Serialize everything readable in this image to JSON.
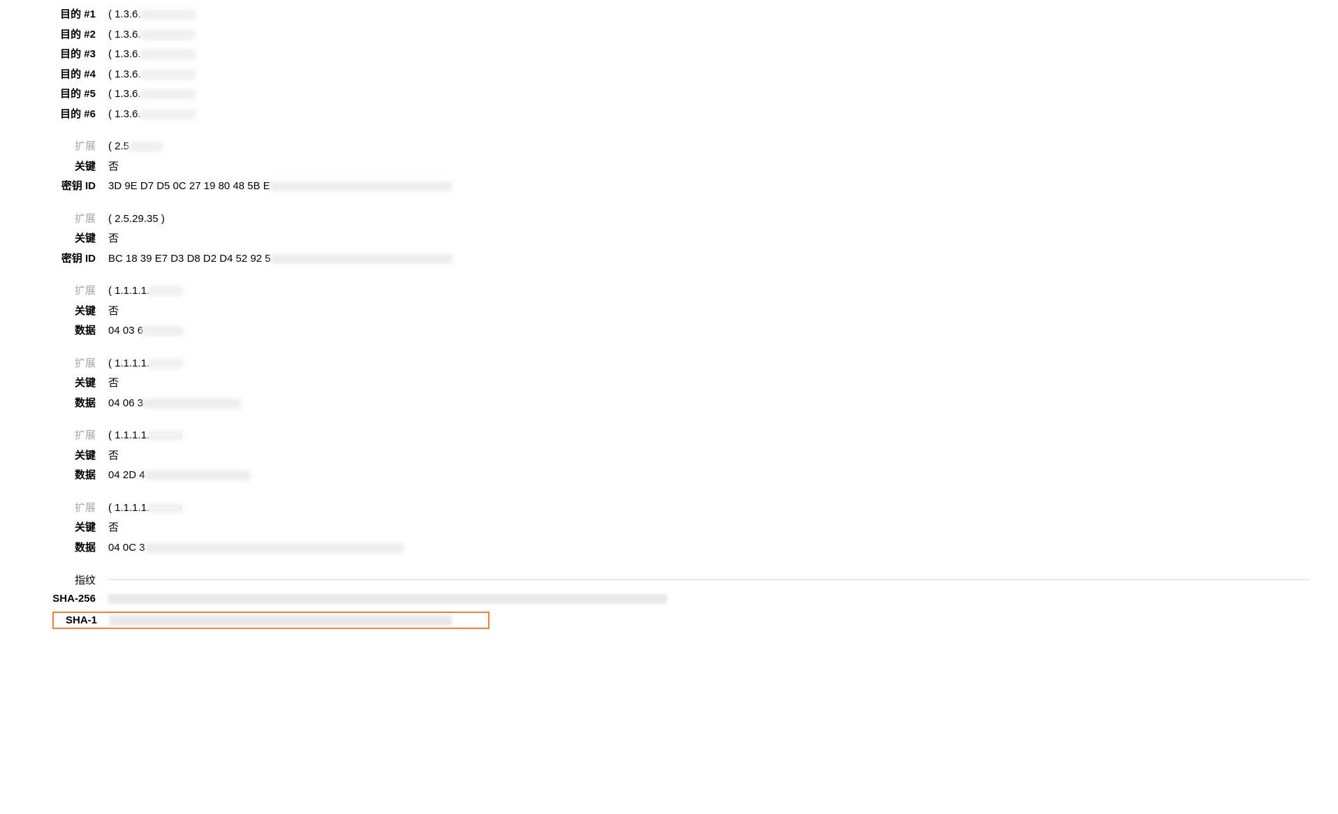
{
  "purposes": [
    {
      "label": "目的 #1",
      "value": "( 1.3.6."
    },
    {
      "label": "目的 #2",
      "value": "( 1.3.6."
    },
    {
      "label": "目的 #3",
      "value": "( 1.3.6."
    },
    {
      "label": "目的 #4",
      "value": "( 1.3.6."
    },
    {
      "label": "目的 #5",
      "value": "( 1.3.6."
    },
    {
      "label": "目的 #6",
      "value": "( 1.3.6."
    }
  ],
  "ext1": {
    "ext_label": "扩展",
    "ext_value": "( 2.5",
    "critical_label": "关键",
    "critical_value": "否",
    "keyid_label": "密钥 ID",
    "keyid_value": "3D 9E D7 D5 0C 27 19 80 48 5B E"
  },
  "ext2": {
    "ext_label": "扩展",
    "ext_value": "( 2.5.29.35 )",
    "critical_label": "关键",
    "critical_value": "否",
    "keyid_label": "密钥 ID",
    "keyid_value": "BC 18 39 E7 D3 D8 D2 D4 52 92 5"
  },
  "ext3": {
    "ext_label": "扩展",
    "ext_value": "( 1.1.1.1.",
    "critical_label": "关键",
    "critical_value": "否",
    "data_label": "数据",
    "data_value": "04 03 6"
  },
  "ext4": {
    "ext_label": "扩展",
    "ext_value": "( 1.1.1.1.",
    "critical_label": "关键",
    "critical_value": "否",
    "data_label": "数据",
    "data_value": "04 06 3"
  },
  "ext5": {
    "ext_label": "扩展",
    "ext_value": "( 1.1.1.1.",
    "critical_label": "关键",
    "critical_value": "否",
    "data_label": "数据",
    "data_value": "04 2D 4"
  },
  "ext6": {
    "ext_label": "扩展",
    "ext_value": "( 1.1.1.1.",
    "critical_label": "关键",
    "critical_value": "否",
    "data_label": "数据",
    "data_value": "04 0C 3"
  },
  "fingerprint": {
    "header_label": "指纹",
    "sha256_label": "SHA-256",
    "sha1_label": "SHA-1"
  }
}
